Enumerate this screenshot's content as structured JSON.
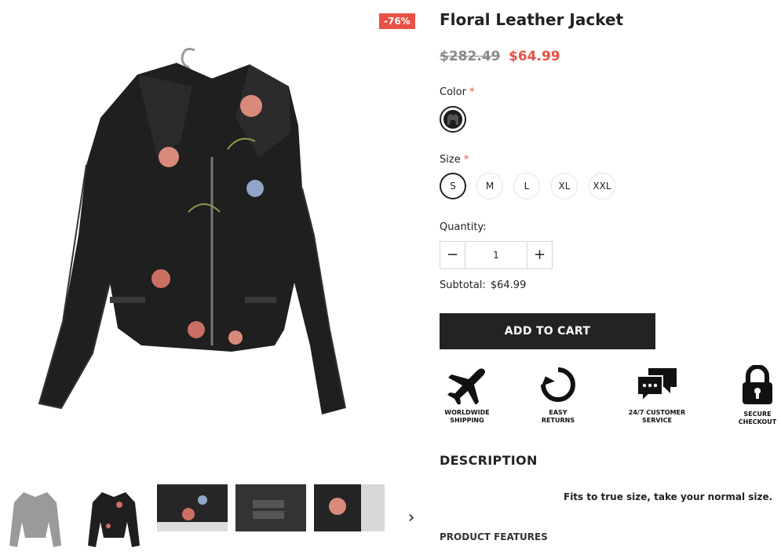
{
  "product": {
    "title": "Floral Leather Jacket",
    "discount_badge": "-76%",
    "price_old": "$282.49",
    "price_new": "$64.99",
    "color_label": "Color",
    "required_mark": "*",
    "size_label": "Size",
    "sizes": [
      "S",
      "M",
      "L",
      "XL",
      "XXL"
    ],
    "selected_size": "S",
    "quantity_label": "Quantity:",
    "quantity_value": "1",
    "subtotal_label": "Subtotal:",
    "subtotal_value": "$64.99",
    "add_to_cart": "ADD TO CART"
  },
  "badges": [
    {
      "icon": "airplane-icon",
      "text": "WORLDWIDE\nSHIPPING"
    },
    {
      "icon": "returns-icon",
      "text": "EASY\nRETURNS"
    },
    {
      "icon": "chat-icon",
      "text": "24/7 CUSTOMER\nSERVICE"
    },
    {
      "icon": "lock-icon",
      "text": "SECURE\nCHECKOUT"
    }
  ],
  "description": {
    "title": "DESCRIPTION",
    "text": "Fits to true size, take your normal size.",
    "features_title": "PRODUCT FEATURES"
  },
  "colors": {
    "accent": "#e95144",
    "button": "#232323",
    "jacket": "#1d1d1d"
  }
}
